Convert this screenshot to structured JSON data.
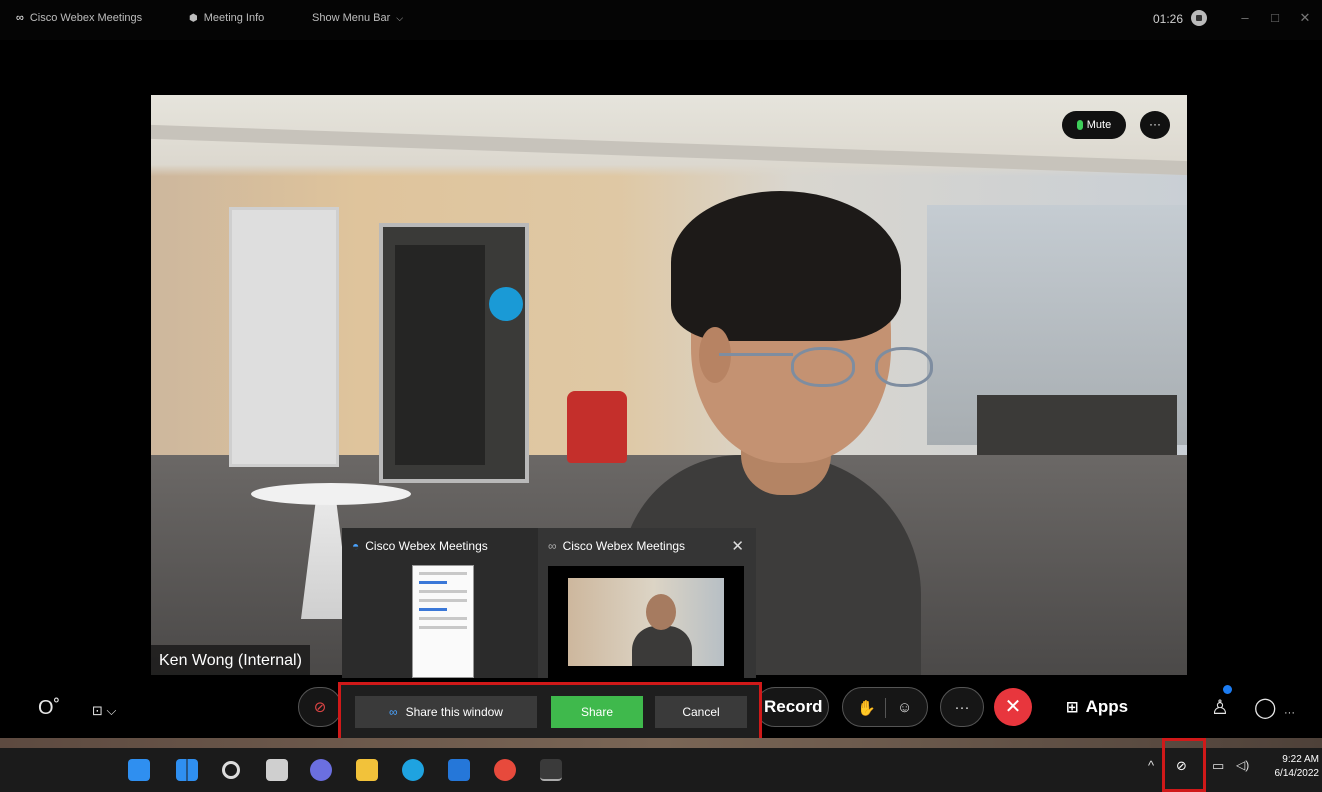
{
  "titlebar": {
    "app_name": "Cisco Webex Meetings",
    "meeting_info": "Meeting Info",
    "show_menu_bar": "Show Menu Bar",
    "timer": "01:26",
    "minimize": "–",
    "maximize": "□",
    "close": "✕"
  },
  "video": {
    "mute_label": "Mute",
    "more_label": "···",
    "participant_name": "Ken Wong (Internal)"
  },
  "share_preview": {
    "window_a_title": "Cisco Webex Meetings",
    "window_b_title": "Cisco Webex Meetings",
    "close_glyph": "✕"
  },
  "share_bar": {
    "share_this_window": "Share this window",
    "share": "Share",
    "cancel": "Cancel"
  },
  "toolbar": {
    "record_label": "Record",
    "apps_label": "Apps",
    "more_glyph": "···"
  },
  "taskbar": {
    "time": "9:22 AM",
    "date": "6/14/2022",
    "colors": {
      "windows": "#2f8ff0",
      "files": "#f2c23a",
      "edge": "#1fa3e0",
      "store": "#2577d9",
      "chrome": "#e74a3c",
      "teams": "#6b6fe0"
    }
  },
  "colors": {
    "end_call": "#e8363d",
    "share_green": "#3fb94c",
    "highlight_red": "#d01919"
  }
}
